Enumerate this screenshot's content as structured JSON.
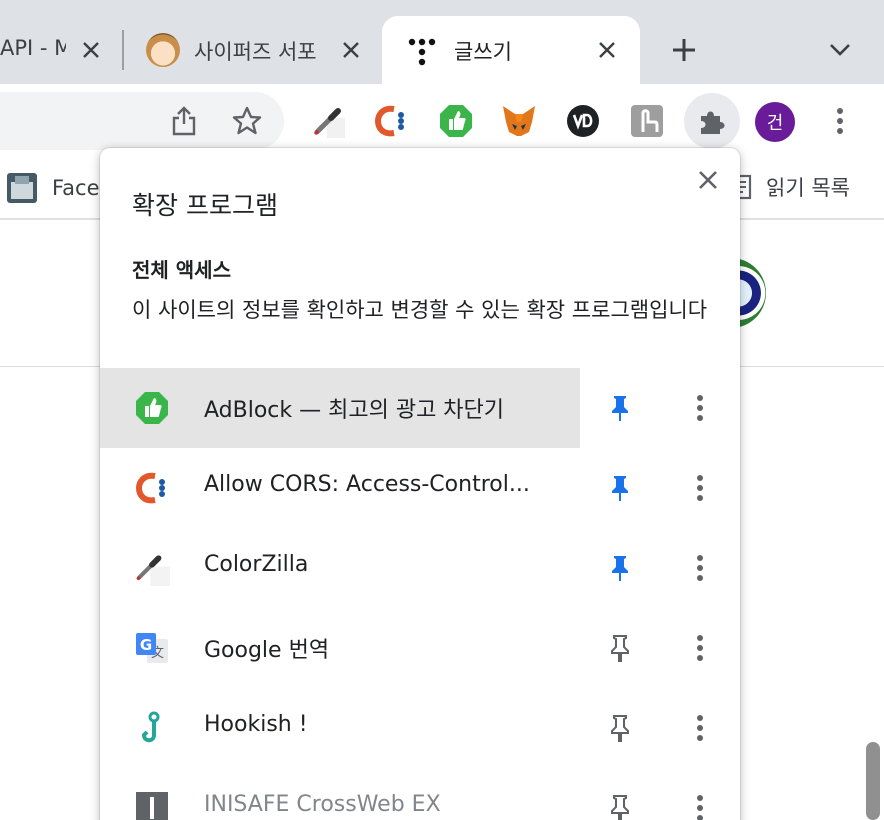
{
  "tabs": [
    {
      "title": "API - M",
      "active": false
    },
    {
      "title": "사이퍼즈 서포",
      "active": false
    },
    {
      "title": "글쓰기",
      "active": true
    }
  ],
  "toolbar": {
    "avatar_initial": "건",
    "extension_icons": [
      "colorzilla-icon",
      "allow-cors-icon",
      "adblock-icon",
      "metamask-icon",
      "vd-icon",
      "hookish-icon",
      "extensions-puzzle-icon"
    ]
  },
  "bookmarks": {
    "left_item": "Face",
    "reading_list": "읽기 목록"
  },
  "popup": {
    "title": "확장 프로그램",
    "section_title": "전체 액세스",
    "section_desc": "이 사이트의 정보를 확인하고 변경할 수 있는 확장 프로그램입니다",
    "extensions": [
      {
        "name": "AdBlock — 최고의 광고 차단기",
        "icon": "adblock-icon",
        "pinned": true
      },
      {
        "name": "Allow CORS: Access-Control...",
        "icon": "allow-cors-icon",
        "pinned": true
      },
      {
        "name": "ColorZilla",
        "icon": "colorzilla-icon",
        "pinned": true
      },
      {
        "name": "Google 번역",
        "icon": "google-translate-icon",
        "pinned": false
      },
      {
        "name": "Hookish !",
        "icon": "hookish-icon",
        "pinned": false
      },
      {
        "name": "INISAFE CrossWeb EX",
        "icon": "inisafe-icon",
        "pinned": false
      }
    ]
  },
  "colors": {
    "pin_active": "#1a73e8",
    "pin_inactive": "#5f6368",
    "adblock_green": "#3ab54a",
    "cors_orange": "#e2572b",
    "avatar_purple": "#6a1b9a"
  }
}
